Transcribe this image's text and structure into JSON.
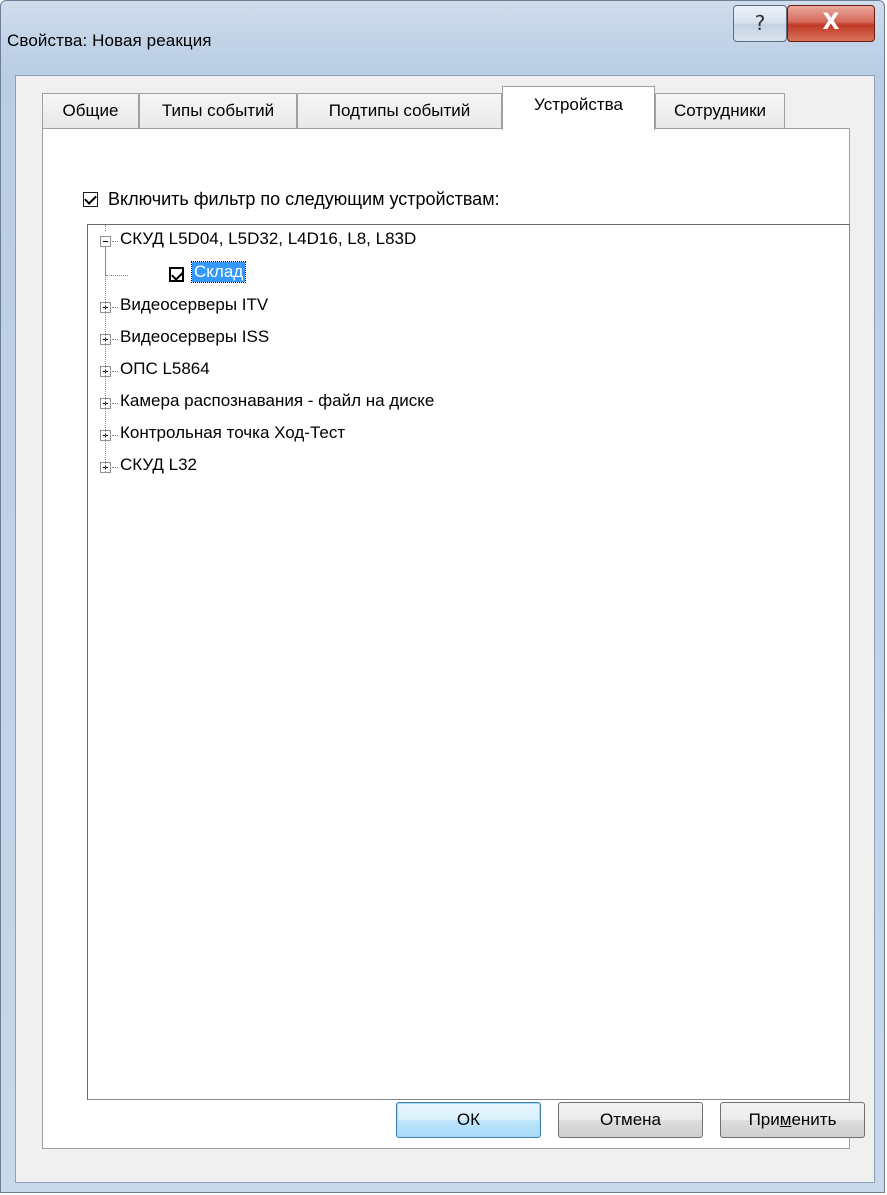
{
  "window": {
    "title": "Свойства: Новая реакция",
    "help_label": "?",
    "close_label": "X"
  },
  "tabs": [
    {
      "label": "Общие",
      "active": false
    },
    {
      "label": "Типы событий",
      "active": false
    },
    {
      "label": "Подтипы событий",
      "active": false
    },
    {
      "label": "Устройства",
      "active": true
    },
    {
      "label": "Сотрудники",
      "active": false
    }
  ],
  "filter": {
    "checked": true,
    "label": "Включить фильтр по следующим устройствам:"
  },
  "tree": {
    "root_expanded": {
      "label": "СКУД L5D04, L5D32, L4D16, L8, L83D",
      "expanded": true,
      "children": [
        {
          "label": "Склад",
          "checked": true,
          "selected": true
        }
      ]
    },
    "collapsed_items": [
      "Видеосерверы ITV",
      "Видеосерверы ISS",
      "ОПС L5864",
      "Камера распознавания - файл на диске",
      "Контрольная точка Ход-Тест",
      "СКУД L32"
    ]
  },
  "buttons": {
    "ok": "ОК",
    "cancel": "Отмена",
    "apply_prefix": "При",
    "apply_mnemonic": "м",
    "apply_suffix": "енить"
  }
}
